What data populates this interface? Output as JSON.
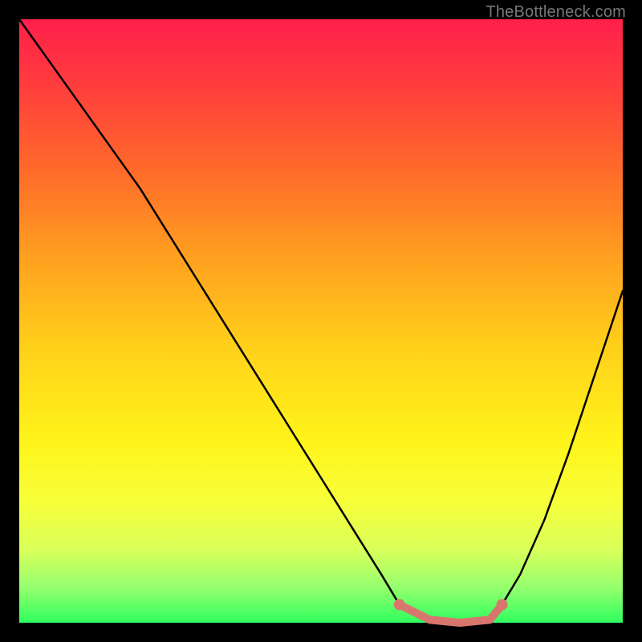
{
  "attribution": "TheBottleneck.com",
  "colors": {
    "frame": "#000000",
    "curve": "#000000",
    "highlight": "#d8766e",
    "highlight_endcap": "#d8766e"
  },
  "chart_data": {
    "type": "line",
    "title": "",
    "xlabel": "",
    "ylabel": "",
    "xlim": [
      0,
      100
    ],
    "ylim": [
      0,
      100
    ],
    "series": [
      {
        "name": "bottleneck-curve",
        "x": [
          0,
          5,
          10,
          15,
          20,
          25,
          30,
          35,
          40,
          45,
          50,
          55,
          60,
          63,
          68,
          73,
          78,
          80,
          83,
          87,
          91,
          95,
          100
        ],
        "values": [
          100,
          93,
          86,
          79,
          72,
          64,
          56,
          48,
          40,
          32,
          24,
          16,
          8,
          3,
          0.5,
          0,
          0.5,
          3,
          8,
          17,
          28,
          40,
          55
        ]
      }
    ],
    "annotations": [
      {
        "name": "optimal-range",
        "x_start": 63,
        "x_end": 80
      }
    ]
  }
}
